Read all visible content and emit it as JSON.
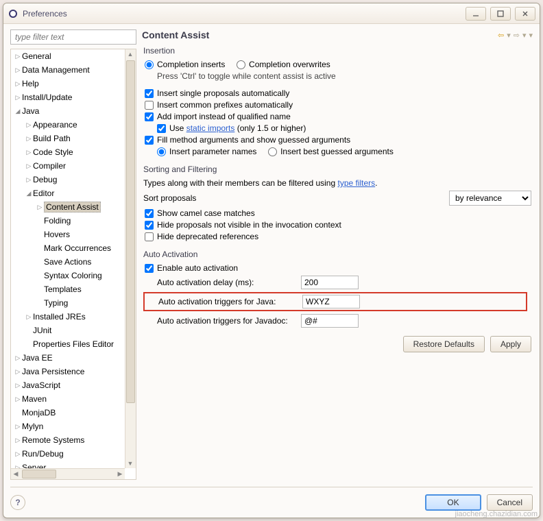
{
  "window": {
    "title": "Preferences"
  },
  "filter": {
    "placeholder": "type filter text"
  },
  "tree": {
    "items": [
      {
        "l": "General",
        "d": 0,
        "tw": "▷"
      },
      {
        "l": "Data Management",
        "d": 0,
        "tw": "▷"
      },
      {
        "l": "Help",
        "d": 0,
        "tw": "▷"
      },
      {
        "l": "Install/Update",
        "d": 0,
        "tw": "▷"
      },
      {
        "l": "Java",
        "d": 0,
        "tw": "◢"
      },
      {
        "l": "Appearance",
        "d": 1,
        "tw": "▷"
      },
      {
        "l": "Build Path",
        "d": 1,
        "tw": "▷"
      },
      {
        "l": "Code Style",
        "d": 1,
        "tw": "▷"
      },
      {
        "l": "Compiler",
        "d": 1,
        "tw": "▷"
      },
      {
        "l": "Debug",
        "d": 1,
        "tw": "▷"
      },
      {
        "l": "Editor",
        "d": 1,
        "tw": "◢"
      },
      {
        "l": "Content Assist",
        "d": 2,
        "tw": "▷",
        "sel": true
      },
      {
        "l": "Folding",
        "d": 2,
        "tw": ""
      },
      {
        "l": "Hovers",
        "d": 2,
        "tw": ""
      },
      {
        "l": "Mark Occurrences",
        "d": 2,
        "tw": ""
      },
      {
        "l": "Save Actions",
        "d": 2,
        "tw": ""
      },
      {
        "l": "Syntax Coloring",
        "d": 2,
        "tw": ""
      },
      {
        "l": "Templates",
        "d": 2,
        "tw": ""
      },
      {
        "l": "Typing",
        "d": 2,
        "tw": ""
      },
      {
        "l": "Installed JREs",
        "d": 1,
        "tw": "▷"
      },
      {
        "l": "JUnit",
        "d": 1,
        "tw": ""
      },
      {
        "l": "Properties Files Editor",
        "d": 1,
        "tw": ""
      },
      {
        "l": "Java EE",
        "d": 0,
        "tw": "▷"
      },
      {
        "l": "Java Persistence",
        "d": 0,
        "tw": "▷"
      },
      {
        "l": "JavaScript",
        "d": 0,
        "tw": "▷"
      },
      {
        "l": "Maven",
        "d": 0,
        "tw": "▷"
      },
      {
        "l": "MonjaDB",
        "d": 0,
        "tw": ""
      },
      {
        "l": "Mylyn",
        "d": 0,
        "tw": "▷"
      },
      {
        "l": "Remote Systems",
        "d": 0,
        "tw": "▷"
      },
      {
        "l": "Run/Debug",
        "d": 0,
        "tw": "▷"
      },
      {
        "l": "Server",
        "d": 0,
        "tw": "▷"
      }
    ]
  },
  "page": {
    "title": "Content Assist",
    "insertion": {
      "group": "Insertion",
      "completion_inserts": "Completion inserts",
      "completion_overwrites": "Completion overwrites",
      "ctrl_hint": "Press 'Ctrl' to toggle while content assist is active",
      "insert_single": "Insert single proposals automatically",
      "insert_common": "Insert common prefixes automatically",
      "add_import": "Add import instead of qualified name",
      "use_prefix": "Use ",
      "static_imports": "static imports",
      "use_suffix": " (only 1.5 or higher)",
      "fill_method": "Fill method arguments and show guessed arguments",
      "insert_param": "Insert parameter names",
      "insert_best": "Insert best guessed arguments"
    },
    "sorting": {
      "group": "Sorting and Filtering",
      "filter_text": "Types along with their members can be filtered using ",
      "filter_link": "type filters",
      "sort_label": "Sort proposals",
      "sort_value": "by relevance",
      "camel": "Show camel case matches",
      "hide_invoc": "Hide proposals not visible in the invocation context",
      "hide_depr": "Hide deprecated references"
    },
    "auto": {
      "group": "Auto Activation",
      "enable": "Enable auto activation",
      "delay_label": "Auto activation delay (ms):",
      "delay_value": "200",
      "java_label": "Auto activation triggers for Java:",
      "java_value": "WXYZ",
      "javadoc_label": "Auto activation triggers for Javadoc:",
      "javadoc_value": "@#"
    },
    "buttons": {
      "restore": "Restore Defaults",
      "apply": "Apply",
      "ok": "OK",
      "cancel": "Cancel"
    }
  },
  "watermark": "jiaocheng.chazidian.com"
}
